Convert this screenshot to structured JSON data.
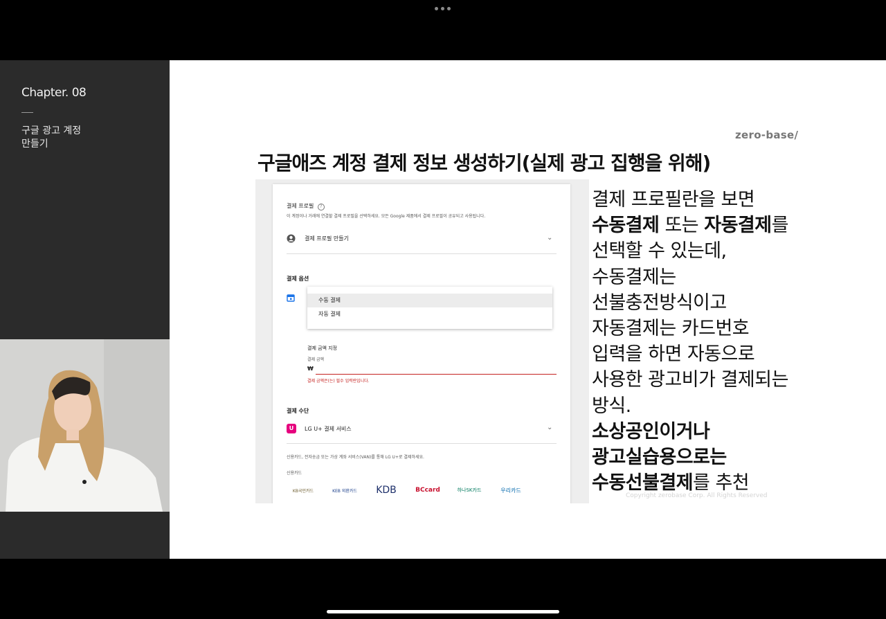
{
  "sidebar": {
    "chapter": "Chapter. 08",
    "lesson_title_line1": "구글 광고 계정",
    "lesson_title_line2": "만들기"
  },
  "slide": {
    "brand": "zero-base/",
    "title": "구글애즈 계정 결제 정보 생성하기(실제 광고 집행을 위해)",
    "copyright": "Copyright zerobase Corp. All Rights Reserved",
    "description_lines": [
      {
        "parts": [
          {
            "text": "결제 프로필란을 보면",
            "bold": false
          }
        ]
      },
      {
        "parts": [
          {
            "text": "수동결제",
            "bold": true
          },
          {
            "text": " 또는 ",
            "bold": false
          },
          {
            "text": "자동결제",
            "bold": true
          },
          {
            "text": "를",
            "bold": false
          }
        ]
      },
      {
        "parts": [
          {
            "text": "선택할 수 있는데,",
            "bold": false
          }
        ]
      },
      {
        "parts": [
          {
            "text": "수동결제는",
            "bold": false
          }
        ]
      },
      {
        "parts": [
          {
            "text": "선불충전방식이고",
            "bold": false
          }
        ]
      },
      {
        "parts": [
          {
            "text": "자동결제는 카드번호",
            "bold": false
          }
        ]
      },
      {
        "parts": [
          {
            "text": "입력을 하면 자동으로",
            "bold": false
          }
        ]
      },
      {
        "parts": [
          {
            "text": "사용한 광고비가 결제되는",
            "bold": false
          }
        ]
      },
      {
        "parts": [
          {
            "text": "방식.",
            "bold": false
          }
        ]
      },
      {
        "parts": [
          {
            "text": "소상공인이거나",
            "bold": true
          }
        ]
      },
      {
        "parts": [
          {
            "text": "광고실습용으로는",
            "bold": true
          }
        ]
      },
      {
        "parts": [
          {
            "text": "수동선불결제",
            "bold": true
          },
          {
            "text": "를 추천",
            "bold": false
          }
        ]
      }
    ]
  },
  "screenshot": {
    "profile_heading": "결제 프로필",
    "profile_help": "이 계정이나 거래에 연결할 결제 프로필을 선택하세요. 모든 Google 제품에서 결제 프로필이 공유되고 사용됩니다.",
    "create_profile": "결제 프로필 만들기",
    "option_heading": "결제 옵션",
    "dropdown_options": [
      "수동 결제",
      "자동 결제"
    ],
    "amount_heading": "결제 금액 지정",
    "amount_sublabel": "결제 금액",
    "currency_symbol": "₩",
    "amount_error": "결제 금액은(는) 필수 입력란입니다.",
    "method_heading": "결제 수단",
    "method_name": "LG U+ 결제 서비스",
    "method_help": "신용카드, 전자송금 또는 가상 계좌 서비스(VAN)를 통해 LG U+로 결제하세요.",
    "card_heading": "신용카드",
    "card_brands": [
      "KB국민카드",
      "KEB 외환카드",
      "KDB",
      "BCcard",
      "하나SK카드",
      "우리카드"
    ]
  },
  "colors": {
    "sidebar_bg": "#2b2b2b",
    "error": "#c5221f",
    "icon_blue": "#1a73e8",
    "lgu_brand": "#e6007e"
  }
}
